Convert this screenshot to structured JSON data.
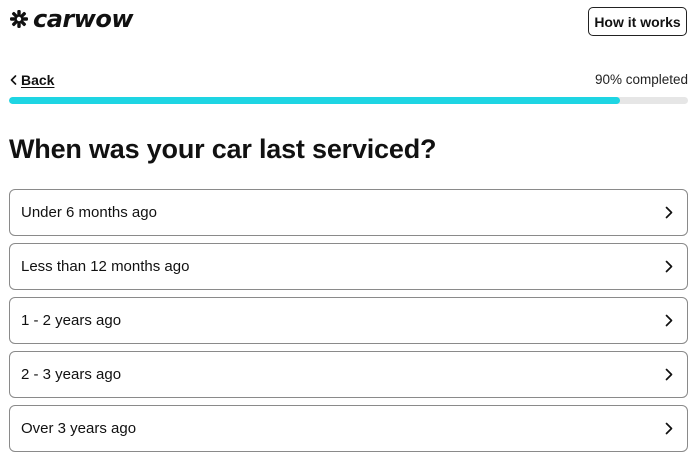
{
  "header": {
    "logo_text": "carwow",
    "logo_icon": "carwow-logo-icon",
    "how_it_works_label": "How it works"
  },
  "nav": {
    "back_label": "Back",
    "back_icon": "chevron-left-icon"
  },
  "progress": {
    "label": "90% completed",
    "fraction": 0.9,
    "fill_color": "#1ed5e3",
    "track_color": "#e6e6e6"
  },
  "question": {
    "title": "When was your car last serviced?"
  },
  "options": [
    {
      "label": "Under 6 months ago"
    },
    {
      "label": "Less than 12 months ago"
    },
    {
      "label": "1 - 2 years ago"
    },
    {
      "label": "2 - 3 years ago"
    },
    {
      "label": "Over 3 years ago"
    }
  ],
  "option_icon": "chevron-right-icon"
}
